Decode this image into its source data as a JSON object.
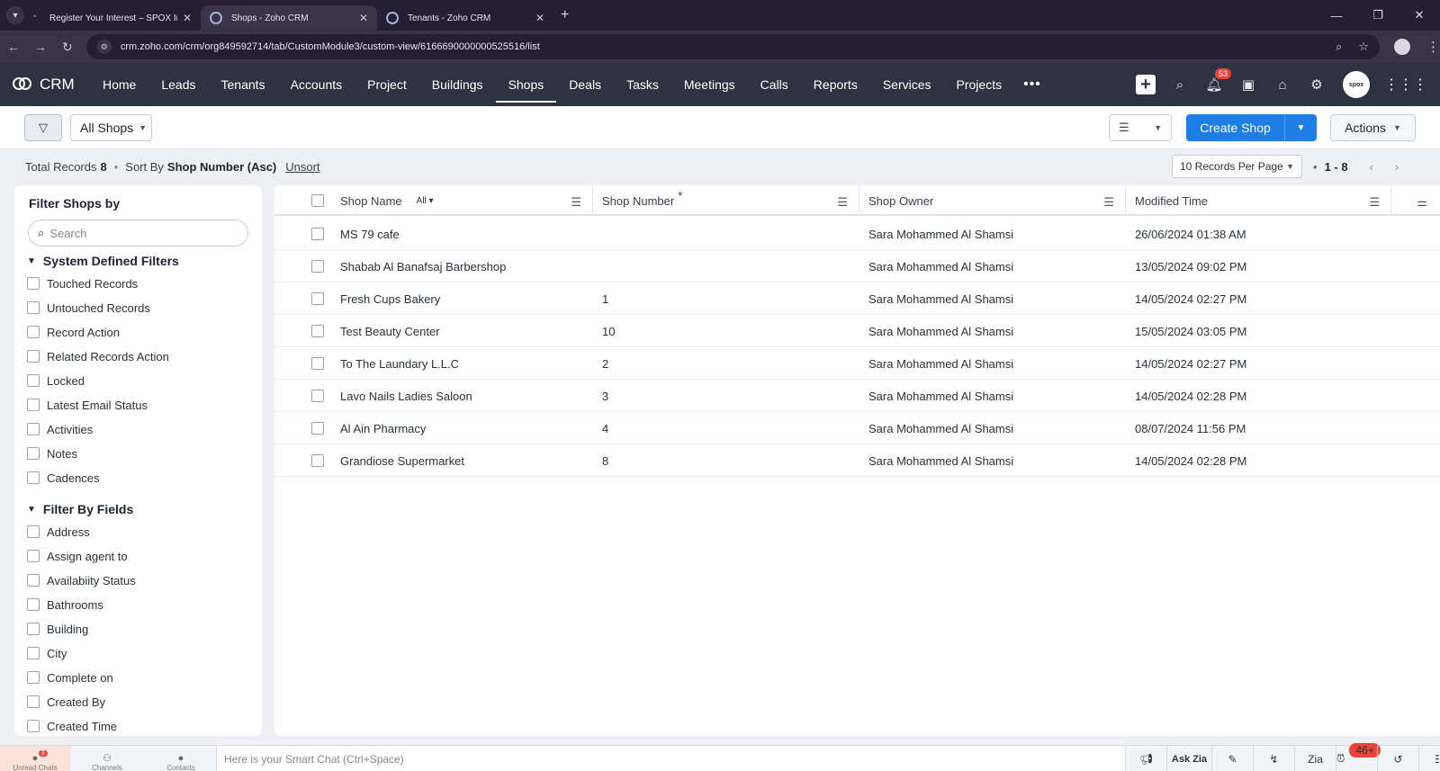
{
  "browser": {
    "tabs": [
      {
        "title": "Register Your Interest – SPOX In"
      },
      {
        "title": "Shops - Zoho CRM"
      },
      {
        "title": "Tenants - Zoho CRM"
      }
    ],
    "url": "crm.zoho.com/crm/org849592714/tab/CustomModule3/custom-view/6166690000000525516/list"
  },
  "crm": {
    "logo": "CRM",
    "nav": [
      "Home",
      "Leads",
      "Tenants",
      "Accounts",
      "Project",
      "Buildings",
      "Shops",
      "Deals",
      "Tasks",
      "Meetings",
      "Calls",
      "Reports",
      "Services",
      "Projects"
    ],
    "active_nav": "Shops",
    "notification_count": "53",
    "avatar_text": "spox"
  },
  "toolbar": {
    "view_label": "All Shops",
    "create_label": "Create Shop",
    "actions_label": "Actions"
  },
  "summary": {
    "total_label": "Total Records",
    "total_value": "8",
    "sort_label": "Sort By",
    "sort_value": "Shop Number (Asc)",
    "unsort": "Unsort",
    "per_page": "10 Records Per Page",
    "range": "1 - 8"
  },
  "filters": {
    "title": "Filter Shops by",
    "search_placeholder": "Search",
    "system_title": "System Defined Filters",
    "system": [
      "Touched Records",
      "Untouched Records",
      "Record Action",
      "Related Records Action",
      "Locked",
      "Latest Email Status",
      "Activities",
      "Notes",
      "Cadences"
    ],
    "fields_title": "Filter By Fields",
    "fields": [
      "Address",
      "Assign agent to",
      "Availabiity Status",
      "Bathrooms",
      "Building",
      "City",
      "Complete on",
      "Created By",
      "Created Time"
    ]
  },
  "table": {
    "columns": [
      "Shop Name",
      "Shop Number",
      "Shop Owner",
      "Modified Time"
    ],
    "all_filter": "All",
    "required_mark": "*",
    "rows": [
      [
        "MS 79 cafe",
        "",
        "Sara Mohammed Al Shamsi",
        "26/06/2024 01:38 AM"
      ],
      [
        "Shabab Al Banafsaj Barbershop",
        "",
        "Sara Mohammed Al Shamsi",
        "13/05/2024 09:02 PM"
      ],
      [
        "Fresh Cups Bakery",
        "1",
        "Sara Mohammed Al Shamsi",
        "14/05/2024 02:27 PM"
      ],
      [
        "Test Beauty Center",
        "10",
        "Sara Mohammed Al Shamsi",
        "15/05/2024 03:05 PM"
      ],
      [
        "To The Laundary L.L.C",
        "2",
        "Sara Mohammed Al Shamsi",
        "14/05/2024 02:27 PM"
      ],
      [
        "Lavo Nails Ladies Saloon",
        "3",
        "Sara Mohammed Al Shamsi",
        "14/05/2024 02:28 PM"
      ],
      [
        "Al Ain Pharmacy",
        "4",
        "Sara Mohammed Al Shamsi",
        "08/07/2024 11:56 PM"
      ],
      [
        "Grandiose Supermarket",
        "8",
        "Sara Mohammed Al Shamsi",
        "14/05/2024 02:28 PM"
      ]
    ]
  },
  "bottombar": {
    "unread_chats": "Unread Chats",
    "unread_count": "3",
    "channels": "Channels",
    "contacts": "Contacts",
    "smart_chat_placeholder": "Here is your Smart Chat (Ctrl+Space)",
    "ask_zia": "Ask Zia",
    "zia_label": "Zia",
    "alarm_count": "46+"
  },
  "colors": {
    "accent": "#1f7de6",
    "nav_bg": "#2d3340",
    "badge": "#e6453a"
  }
}
